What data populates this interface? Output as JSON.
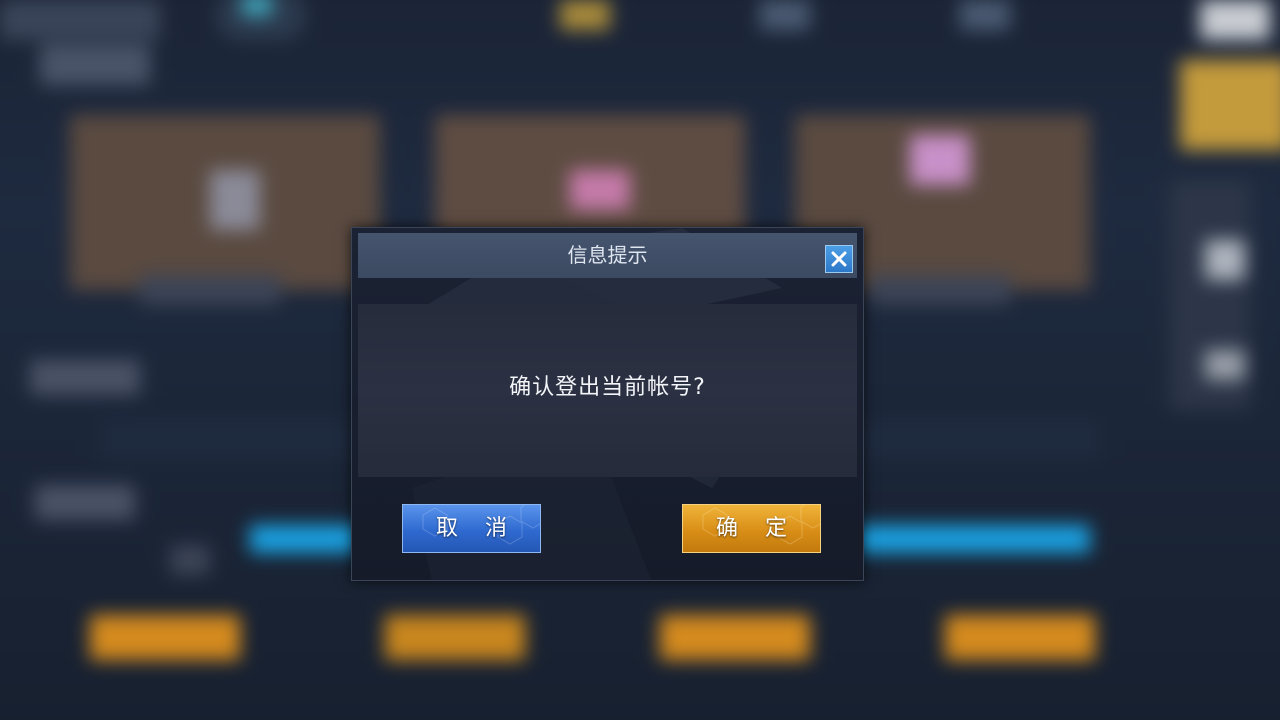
{
  "dialog": {
    "title": "信息提示",
    "message": "确认登出当前帐号?",
    "cancel_label": "取 消",
    "confirm_label": "确 定"
  },
  "icons": {
    "close": "close-x-icon"
  },
  "colors": {
    "cancel_button": "#2f6ad0",
    "confirm_button": "#d98e17",
    "close_button": "#2c78c8",
    "header": "#3b4961"
  }
}
